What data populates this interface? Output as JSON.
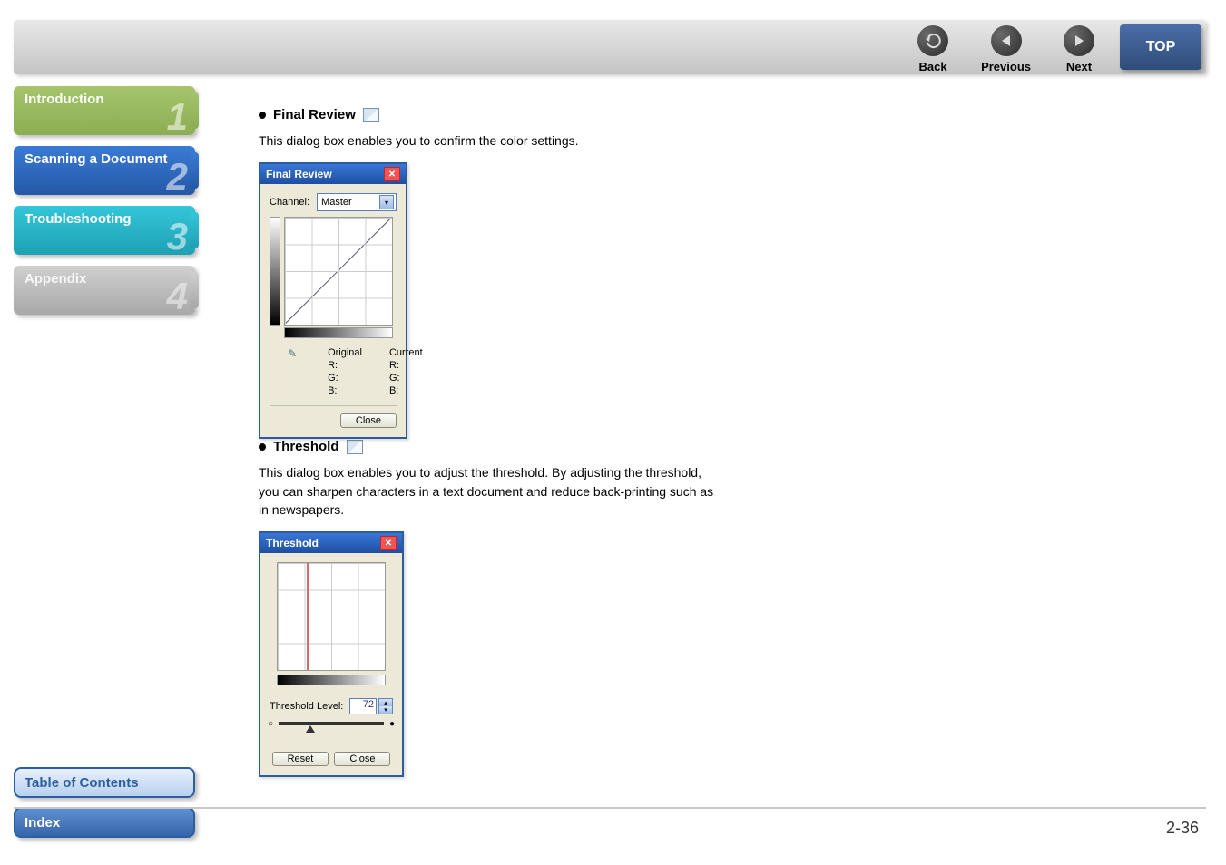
{
  "topbar": {
    "back": "Back",
    "previous": "Previous",
    "next": "Next",
    "top": "TOP"
  },
  "sidebar": {
    "items": [
      {
        "label": "Introduction",
        "num": "1"
      },
      {
        "label": "Scanning a Document",
        "num": "2"
      },
      {
        "label": "Troubleshooting",
        "num": "3"
      },
      {
        "label": "Appendix",
        "num": "4"
      }
    ],
    "toc": "Table of Contents",
    "index": "Index"
  },
  "left_section": {
    "title": "Final Review",
    "desc": "This dialog box enables you to confirm the color settings.",
    "dialog": {
      "title": "Final Review",
      "channel_label": "Channel:",
      "channel_value": "Master",
      "col_original": "Original",
      "col_current": "Current",
      "r": "R:",
      "g": "G:",
      "b": "B:",
      "close": "Close"
    }
  },
  "right_section": {
    "title": "Threshold",
    "desc": "This dialog box enables you to adjust the threshold. By adjusting the threshold, you can sharpen characters in a text document and reduce back-printing such as in newspapers.",
    "dialog": {
      "title": "Threshold",
      "level_label": "Threshold Level:",
      "level_value": "72",
      "reset": "Reset",
      "close": "Close"
    }
  },
  "page_number": "2-36"
}
